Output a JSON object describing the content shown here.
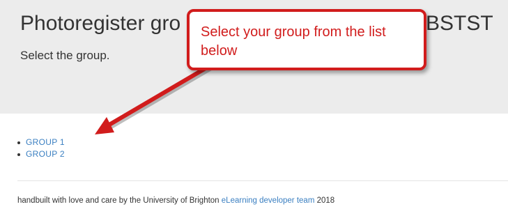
{
  "header": {
    "title_start": "Photoregister gro",
    "title_end": "BSTST",
    "subtitle": "Select the group."
  },
  "callout": {
    "text": "Select your group from the list below"
  },
  "groups": [
    {
      "label": "GROUP 1"
    },
    {
      "label": "GROUP 2"
    }
  ],
  "footer": {
    "text_before": "handbuilt with love and care by the University of Brighton ",
    "link_label": "eLearning developer team",
    "text_after": " 2018"
  },
  "colors": {
    "header_bg": "#ececec",
    "link": "#3a7fc1",
    "annotation": "#d11c1c"
  }
}
